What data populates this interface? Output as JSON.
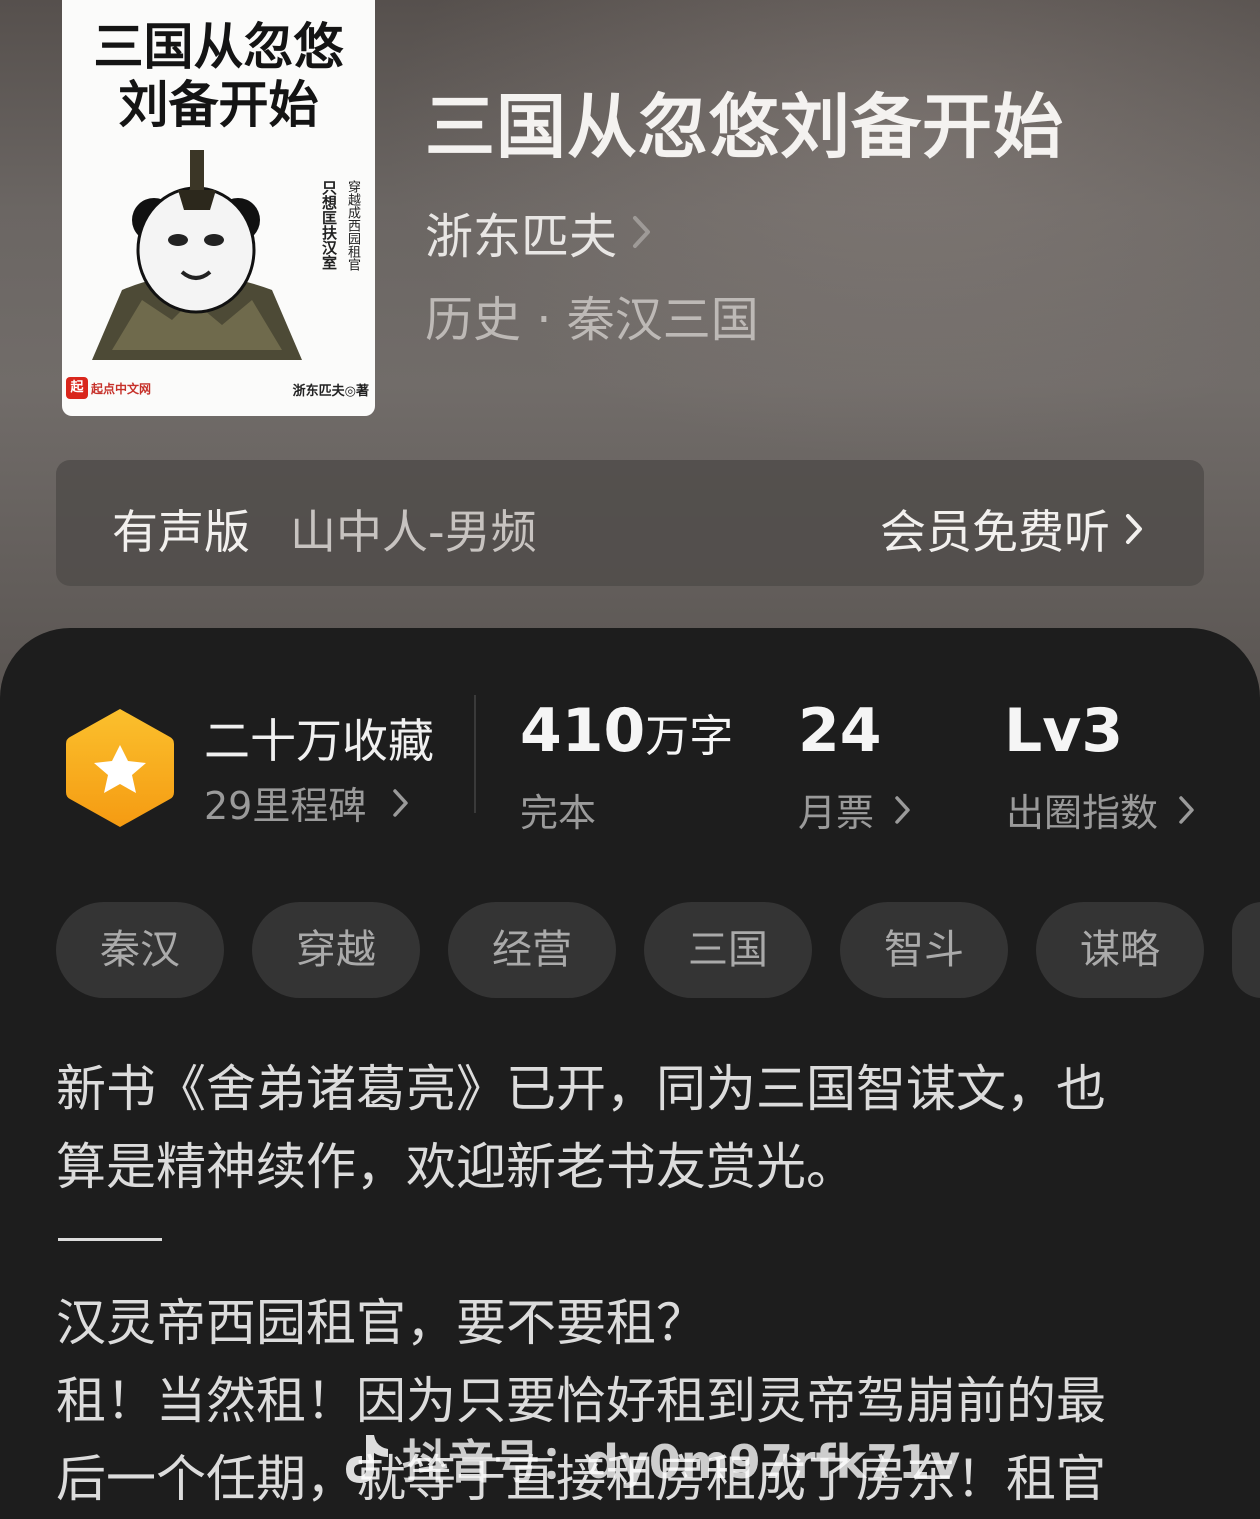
{
  "cover": {
    "title_line1": "三国从忽悠",
    "title_line2": "刘备开始",
    "vertical_text_1": "穿越成西园租官",
    "vertical_text_2": "只想匡扶汉室",
    "publisher_badge": "起",
    "publisher": "起点中文网",
    "author_credit": "浙东匹夫◎著"
  },
  "book": {
    "title": "三国从忽悠刘备开始",
    "author": "浙东匹夫",
    "genre": "历史 · 秦汉三国"
  },
  "audio": {
    "label": "有声版",
    "narrator": "山中人-男频",
    "cta": "会员免费听"
  },
  "stats": {
    "favorites_title": "二十万收藏",
    "milestones": "29里程碑",
    "word_count_num": "410",
    "word_count_unit": "万字",
    "status": "完本",
    "monthly_votes": "24",
    "monthly_votes_label": "月票",
    "level": "Lv3",
    "level_label": "出圈指数"
  },
  "tags": [
    "秦汉",
    "穿越",
    "经营",
    "三国",
    "智斗",
    "谋略"
  ],
  "description": {
    "line1": "新书《舍弟诸葛亮》已开，同为三国智谋文，也",
    "line2": "算是精神续作，欢迎新老书友赏光。",
    "line3": "汉灵帝西园租官，要不要租？",
    "line4": "租！当然租！因为只要恰好租到灵帝驾崩前的最",
    "line5": "后一个任期，就等于直接租房租成了房东！租官"
  },
  "watermark": {
    "text": "抖音号：dy0m97rfk71v"
  },
  "colors": {
    "badge_orange": "#f8a81b",
    "panel_bg": "#1d1d1d",
    "tag_bg": "#343434"
  }
}
